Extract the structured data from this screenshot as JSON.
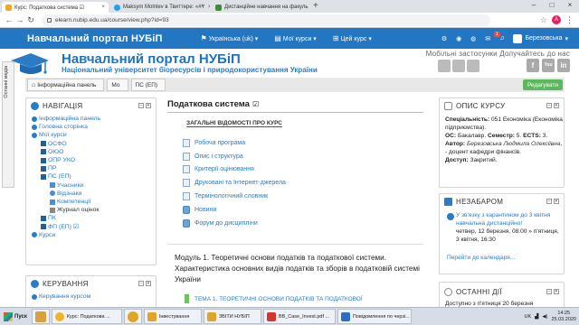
{
  "browser": {
    "tabs": [
      {
        "title": "Курс: Податкова система ☑",
        "active": true
      },
      {
        "title": "Maksym Molnlev в Твиттере: «#Ұ",
        "active": false
      },
      {
        "title": "Дистанційне навчання на факуль",
        "active": false
      }
    ],
    "url": "elearn.nubip.edu.ua/course/view.php?id=93",
    "profile_initial": "A"
  },
  "topnav": {
    "brand": "Навчальний портал НУБіП",
    "language": "Українська (uk)",
    "my_courses": "Мої курси",
    "this_course": "Цей курс",
    "notification_count": "1",
    "user_name": "Березовська"
  },
  "header": {
    "title": "Навчальний портал НУБіП",
    "subtitle": "Національний університет біоресурсів і природокористування України",
    "mobile_label": "Мобільні застосунки  Долучайтесь до нас",
    "social_icons": [
      "f",
      "You",
      "in"
    ]
  },
  "breadcrumb": {
    "items": [
      "Інформаційна панель",
      "Мо",
      "ПС (ЕП)"
    ],
    "edit_button": "Редагувати"
  },
  "side_tab": {
    "label": "Останні медіа"
  },
  "navigation": {
    "title": "НАВІГАЦІЯ",
    "items": [
      {
        "label": "Інформаційна панель",
        "link": true
      },
      {
        "label": "Головна сторінка",
        "link": true
      },
      {
        "label": "Мої курси",
        "link": true
      },
      {
        "label": "ОСФО",
        "link": true
      },
      {
        "label": "ОЮО",
        "link": true
      },
      {
        "label": "ОПР УКО",
        "link": true
      },
      {
        "label": "ПР",
        "link": true
      },
      {
        "label": "ПС (ЕП)",
        "link": true
      },
      {
        "label": "Учасники",
        "link": true
      },
      {
        "label": "Відзнаки",
        "link": true
      },
      {
        "label": "Компетенції",
        "link": true
      },
      {
        "label": "Журнал оцінок",
        "link": false
      },
      {
        "label": "ПК",
        "link": true
      },
      {
        "label": "ФП (ЕП) ☑",
        "link": true
      },
      {
        "label": "Курси",
        "link": true
      }
    ]
  },
  "admin": {
    "title": "КЕРУВАННЯ",
    "items": [
      {
        "label": "Керування курсом"
      }
    ]
  },
  "main": {
    "title": "Податкова система",
    "title_edit_icon": "☑",
    "general_heading": "ЗАГАЛЬНІ ВІДОМОСТІ ПРО КУРС",
    "resources": [
      {
        "label": "Робоча програма",
        "icon": "file"
      },
      {
        "label": "Опис і структура",
        "icon": "file"
      },
      {
        "label": "Критерії оцінювання",
        "icon": "file"
      },
      {
        "label": "Друковані та Інтернет-джерела",
        "icon": "file"
      },
      {
        "label": "Термінологічний словник",
        "icon": "file"
      },
      {
        "label": "Новини",
        "icon": "forum"
      },
      {
        "label": "Форум до дисципліни",
        "icon": "forum"
      }
    ],
    "module_text": "Модуль 1. Теоретичні основи податків та податкової системи. Характеристика основних видів податків та зборів в податковій системі України",
    "topic_link": "ТЕМА 1. ТЕОРЕТИЧНІ ОСНОВИ ПОДАТКІВ ТА ПОДАТКОВОЇ"
  },
  "course_info": {
    "title": "ОПИС КУРСУ",
    "specialty_label": "Спеціальність:",
    "specialty_value": "051 Економіка (Економіка підприємства).",
    "level_label": "ОС:",
    "level_value": "Бакалавр.",
    "semester_label": "Семестр:",
    "semester_value": "5.",
    "ects_label": "ECTS:",
    "ects_value": "3.",
    "author_label": "Автор:",
    "author_value": "Березовська Людмила Олексіївна",
    "author_rest": ", - доцент кафедри фінансів.",
    "access_label": "Доступ:",
    "access_value": "Закритий."
  },
  "upcoming": {
    "title": "НЕЗАБАРОМ",
    "event_title": "У зв'язку з карантином до 3 квітня навчальна дистанційно!",
    "event_time": "четвер, 12 березня, 08:00 » п'ятниця, 3 квітня, 16:30",
    "calendar_link": "Перейти до календаря..."
  },
  "recent": {
    "title": "ОСТАННІ ДІЇ",
    "text": "Доступно з п'ятниця 20 березня"
  },
  "taskbar": {
    "start": "Пуск",
    "items": [
      {
        "label": "Курс: Податкова ...",
        "color": "#f0b429"
      },
      {
        "label": "Інвестування",
        "color": "#e0a526"
      },
      {
        "label": "ЗВІТИ НУБІП",
        "color": "#e0a526"
      },
      {
        "label": "ВВ_Case_Invest.pdf ...",
        "color": "#d9342b"
      },
      {
        "label": "Повідомлення по черзі...",
        "color": "#2b6cc4"
      }
    ],
    "language": "UK",
    "time": "14:25",
    "date": "25.03.2020"
  }
}
